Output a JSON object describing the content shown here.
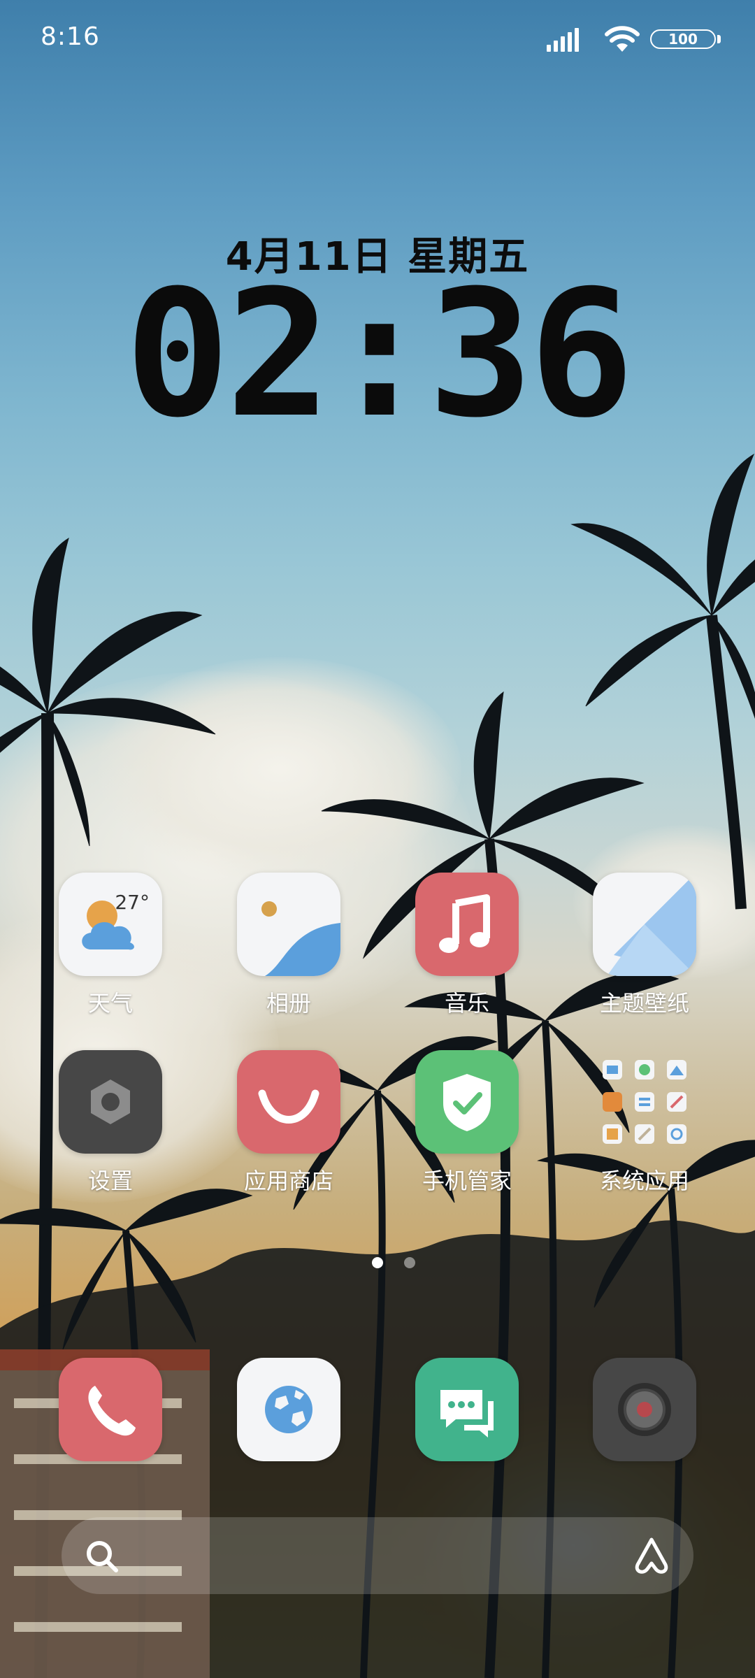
{
  "status_bar": {
    "time": "8:16",
    "battery": "100",
    "icons": [
      "signal-icon",
      "wifi-icon",
      "battery-icon"
    ]
  },
  "clock_widget": {
    "date": "4月11日 星期五",
    "time": "02:36"
  },
  "apps_row1": [
    {
      "label": "天气",
      "icon": "weather-icon",
      "temp": "27°"
    },
    {
      "label": "相册",
      "icon": "gallery-icon"
    },
    {
      "label": "音乐",
      "icon": "music-icon"
    },
    {
      "label": "主题壁纸",
      "icon": "themes-icon"
    }
  ],
  "apps_row2": [
    {
      "label": "设置",
      "icon": "settings-icon"
    },
    {
      "label": "应用商店",
      "icon": "app-store-icon"
    },
    {
      "label": "手机管家",
      "icon": "security-icon"
    },
    {
      "label": "系统应用",
      "icon": "folder-icon"
    }
  ],
  "page_indicator": {
    "pages": 2,
    "active": 1
  },
  "dock": [
    "phone-icon",
    "browser-icon",
    "messages-icon",
    "camera-icon"
  ],
  "search_bar": {
    "icons": [
      "search-icon",
      "assistant-icon"
    ]
  },
  "colors": {
    "music": "#d9686d",
    "app_store": "#d9686d",
    "security": "#5cc177",
    "messages": "#41b38c",
    "settings": "#474747",
    "camera": "#474747"
  }
}
